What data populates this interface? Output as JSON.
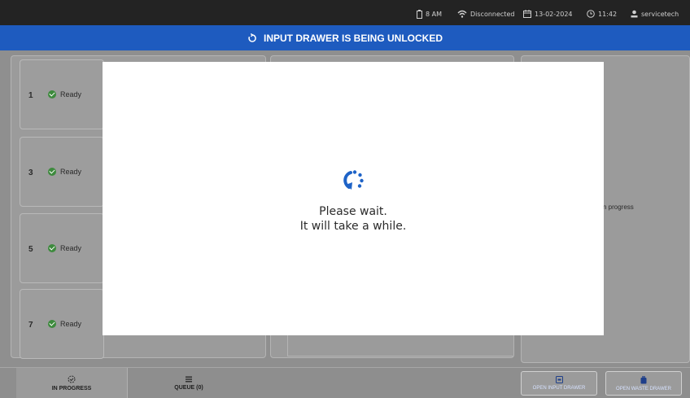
{
  "status_bar": {
    "battery": "8 AM",
    "network": "Disconnected",
    "date": "13-02-2024",
    "time": "11:42",
    "user": "servicetech"
  },
  "banner": {
    "text": "INPUT DRAWER IS BEING UNLOCKED"
  },
  "slots": [
    {
      "number": "1",
      "status": "Ready"
    },
    {
      "number": "3",
      "status": "Ready"
    },
    {
      "number": "5",
      "status": "Ready"
    },
    {
      "number": "7",
      "status": "Ready"
    }
  ],
  "right_panel": {
    "status_text": "n progress"
  },
  "bottom_nav": {
    "tabs": [
      {
        "label": "IN PROGRESS",
        "icon": "in-progress-icon"
      },
      {
        "label": "QUEUE (0)",
        "icon": "list-icon"
      }
    ],
    "buttons": [
      {
        "label": "OPEN INPUT DRAWER",
        "icon": "input-drawer-icon"
      },
      {
        "label": "OPEN WASTE DRAWER",
        "icon": "waste-drawer-icon"
      }
    ]
  },
  "modal": {
    "line1": "Please wait.",
    "line2": "It will take a while."
  },
  "colors": {
    "banner": "#1e5bbf",
    "accent": "#1e63c7",
    "ready": "#3d8a3d"
  }
}
